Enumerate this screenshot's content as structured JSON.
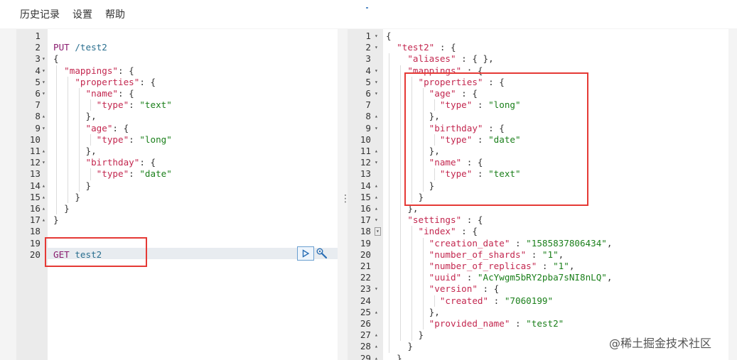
{
  "menu": [
    "历史记录",
    "设置",
    "帮助"
  ],
  "watermark": "@稀土掘金技术社区",
  "left_editor": {
    "lines": [
      {
        "n": "1",
        "fold": "",
        "parts": []
      },
      {
        "n": "2",
        "fold": "",
        "parts": [
          [
            "k",
            "PUT"
          ],
          [
            "p",
            " "
          ],
          [
            "kb",
            "/test2"
          ]
        ]
      },
      {
        "n": "3",
        "fold": "▾",
        "parts": [
          [
            "p",
            "{"
          ]
        ]
      },
      {
        "n": "4",
        "fold": "▾",
        "parts": [
          [
            "p",
            "  "
          ],
          [
            "m",
            "\"mappings\""
          ],
          [
            "p",
            ": {"
          ]
        ]
      },
      {
        "n": "5",
        "fold": "▾",
        "parts": [
          [
            "p",
            "    "
          ],
          [
            "m",
            "\"properties\""
          ],
          [
            "p",
            ": {"
          ]
        ]
      },
      {
        "n": "6",
        "fold": "▾",
        "parts": [
          [
            "p",
            "      "
          ],
          [
            "m",
            "\"name\""
          ],
          [
            "p",
            ": {"
          ]
        ]
      },
      {
        "n": "7",
        "fold": "",
        "parts": [
          [
            "p",
            "        "
          ],
          [
            "m",
            "\"type\""
          ],
          [
            "p",
            ": "
          ],
          [
            "s",
            "\"text\""
          ]
        ]
      },
      {
        "n": "8",
        "fold": "▴",
        "parts": [
          [
            "p",
            "      },"
          ]
        ]
      },
      {
        "n": "9",
        "fold": "▾",
        "parts": [
          [
            "p",
            "      "
          ],
          [
            "m",
            "\"age\""
          ],
          [
            "p",
            ": {"
          ]
        ]
      },
      {
        "n": "10",
        "fold": "",
        "parts": [
          [
            "p",
            "        "
          ],
          [
            "m",
            "\"type\""
          ],
          [
            "p",
            ": "
          ],
          [
            "s",
            "\"long\""
          ]
        ]
      },
      {
        "n": "11",
        "fold": "▴",
        "parts": [
          [
            "p",
            "      },"
          ]
        ]
      },
      {
        "n": "12",
        "fold": "▾",
        "parts": [
          [
            "p",
            "      "
          ],
          [
            "m",
            "\"birthday\""
          ],
          [
            "p",
            ": {"
          ]
        ]
      },
      {
        "n": "13",
        "fold": "",
        "parts": [
          [
            "p",
            "        "
          ],
          [
            "m",
            "\"type\""
          ],
          [
            "p",
            ": "
          ],
          [
            "s",
            "\"date\""
          ]
        ]
      },
      {
        "n": "14",
        "fold": "▴",
        "parts": [
          [
            "p",
            "      }"
          ]
        ]
      },
      {
        "n": "15",
        "fold": "▴",
        "parts": [
          [
            "p",
            "    }"
          ]
        ]
      },
      {
        "n": "16",
        "fold": "▴",
        "parts": [
          [
            "p",
            "  }"
          ]
        ]
      },
      {
        "n": "17",
        "fold": "▴",
        "parts": [
          [
            "p",
            "}"
          ]
        ]
      },
      {
        "n": "18",
        "fold": "",
        "parts": []
      },
      {
        "n": "19",
        "fold": "",
        "parts": []
      },
      {
        "n": "20",
        "fold": "",
        "parts": [
          [
            "k",
            "GET"
          ],
          [
            "p",
            " "
          ],
          [
            "kb",
            "test2"
          ]
        ]
      }
    ]
  },
  "right_editor": {
    "lines": [
      {
        "n": "1",
        "fold": "▾",
        "parts": [
          [
            "p",
            "{"
          ]
        ]
      },
      {
        "n": "2",
        "fold": "▾",
        "parts": [
          [
            "p",
            "  "
          ],
          [
            "m",
            "\"test2\""
          ],
          [
            "p",
            " : {"
          ]
        ]
      },
      {
        "n": "3",
        "fold": "",
        "parts": [
          [
            "p",
            "    "
          ],
          [
            "m",
            "\"aliases\""
          ],
          [
            "p",
            " : { },"
          ]
        ]
      },
      {
        "n": "4",
        "fold": "▾",
        "parts": [
          [
            "p",
            "    "
          ],
          [
            "m",
            "\"mappings\""
          ],
          [
            "p",
            " : {"
          ]
        ]
      },
      {
        "n": "5",
        "fold": "▾",
        "parts": [
          [
            "p",
            "      "
          ],
          [
            "m",
            "\"properties\""
          ],
          [
            "p",
            " : {"
          ]
        ]
      },
      {
        "n": "6",
        "fold": "▾",
        "parts": [
          [
            "p",
            "        "
          ],
          [
            "m",
            "\"age\""
          ],
          [
            "p",
            " : {"
          ]
        ]
      },
      {
        "n": "7",
        "fold": "",
        "parts": [
          [
            "p",
            "          "
          ],
          [
            "m",
            "\"type\""
          ],
          [
            "p",
            " : "
          ],
          [
            "s",
            "\"long\""
          ]
        ]
      },
      {
        "n": "8",
        "fold": "▴",
        "parts": [
          [
            "p",
            "        },"
          ]
        ]
      },
      {
        "n": "9",
        "fold": "▾",
        "parts": [
          [
            "p",
            "        "
          ],
          [
            "m",
            "\"birthday\""
          ],
          [
            "p",
            " : {"
          ]
        ]
      },
      {
        "n": "10",
        "fold": "",
        "parts": [
          [
            "p",
            "          "
          ],
          [
            "m",
            "\"type\""
          ],
          [
            "p",
            " : "
          ],
          [
            "s",
            "\"date\""
          ]
        ]
      },
      {
        "n": "11",
        "fold": "▴",
        "parts": [
          [
            "p",
            "        },"
          ]
        ]
      },
      {
        "n": "12",
        "fold": "▾",
        "parts": [
          [
            "p",
            "        "
          ],
          [
            "m",
            "\"name\""
          ],
          [
            "p",
            " : {"
          ]
        ]
      },
      {
        "n": "13",
        "fold": "",
        "parts": [
          [
            "p",
            "          "
          ],
          [
            "m",
            "\"type\""
          ],
          [
            "p",
            " : "
          ],
          [
            "s",
            "\"text\""
          ]
        ]
      },
      {
        "n": "14",
        "fold": "▴",
        "parts": [
          [
            "p",
            "        }"
          ]
        ]
      },
      {
        "n": "15",
        "fold": "▴",
        "parts": [
          [
            "p",
            "      }"
          ]
        ]
      },
      {
        "n": "16",
        "fold": "▴",
        "parts": [
          [
            "p",
            "    },"
          ]
        ]
      },
      {
        "n": "17",
        "fold": "▾",
        "parts": [
          [
            "p",
            "    "
          ],
          [
            "m",
            "\"settings\""
          ],
          [
            "p",
            " : {"
          ]
        ]
      },
      {
        "n": "18",
        "fold": "▾b",
        "parts": [
          [
            "p",
            "      "
          ],
          [
            "m",
            "\"index\""
          ],
          [
            "p",
            " : {"
          ]
        ]
      },
      {
        "n": "19",
        "fold": "",
        "parts": [
          [
            "p",
            "        "
          ],
          [
            "m",
            "\"creation_date\""
          ],
          [
            "p",
            " : "
          ],
          [
            "s",
            "\"1585837806434\""
          ],
          [
            "p",
            ","
          ]
        ]
      },
      {
        "n": "20",
        "fold": "",
        "parts": [
          [
            "p",
            "        "
          ],
          [
            "m",
            "\"number_of_shards\""
          ],
          [
            "p",
            " : "
          ],
          [
            "s",
            "\"1\""
          ],
          [
            "p",
            ","
          ]
        ]
      },
      {
        "n": "21",
        "fold": "",
        "parts": [
          [
            "p",
            "        "
          ],
          [
            "m",
            "\"number_of_replicas\""
          ],
          [
            "p",
            " : "
          ],
          [
            "s",
            "\"1\""
          ],
          [
            "p",
            ","
          ]
        ]
      },
      {
        "n": "22",
        "fold": "",
        "parts": [
          [
            "p",
            "        "
          ],
          [
            "m",
            "\"uuid\""
          ],
          [
            "p",
            " : "
          ],
          [
            "s",
            "\"AcYwgm5bRY2pba7sNI8nLQ\""
          ],
          [
            "p",
            ","
          ]
        ]
      },
      {
        "n": "23",
        "fold": "▾",
        "parts": [
          [
            "p",
            "        "
          ],
          [
            "m",
            "\"version\""
          ],
          [
            "p",
            " : {"
          ]
        ]
      },
      {
        "n": "24",
        "fold": "",
        "parts": [
          [
            "p",
            "          "
          ],
          [
            "m",
            "\"created\""
          ],
          [
            "p",
            " : "
          ],
          [
            "s",
            "\"7060199\""
          ]
        ]
      },
      {
        "n": "25",
        "fold": "▴",
        "parts": [
          [
            "p",
            "        },"
          ]
        ]
      },
      {
        "n": "26",
        "fold": "",
        "parts": [
          [
            "p",
            "        "
          ],
          [
            "m",
            "\"provided_name\""
          ],
          [
            "p",
            " : "
          ],
          [
            "s",
            "\"test2\""
          ]
        ]
      },
      {
        "n": "27",
        "fold": "▴",
        "parts": [
          [
            "p",
            "      }"
          ]
        ]
      },
      {
        "n": "28",
        "fold": "▴",
        "parts": [
          [
            "p",
            "    }"
          ]
        ]
      },
      {
        "n": "29",
        "fold": "▴",
        "parts": [
          [
            "p",
            "  }"
          ]
        ]
      }
    ]
  }
}
